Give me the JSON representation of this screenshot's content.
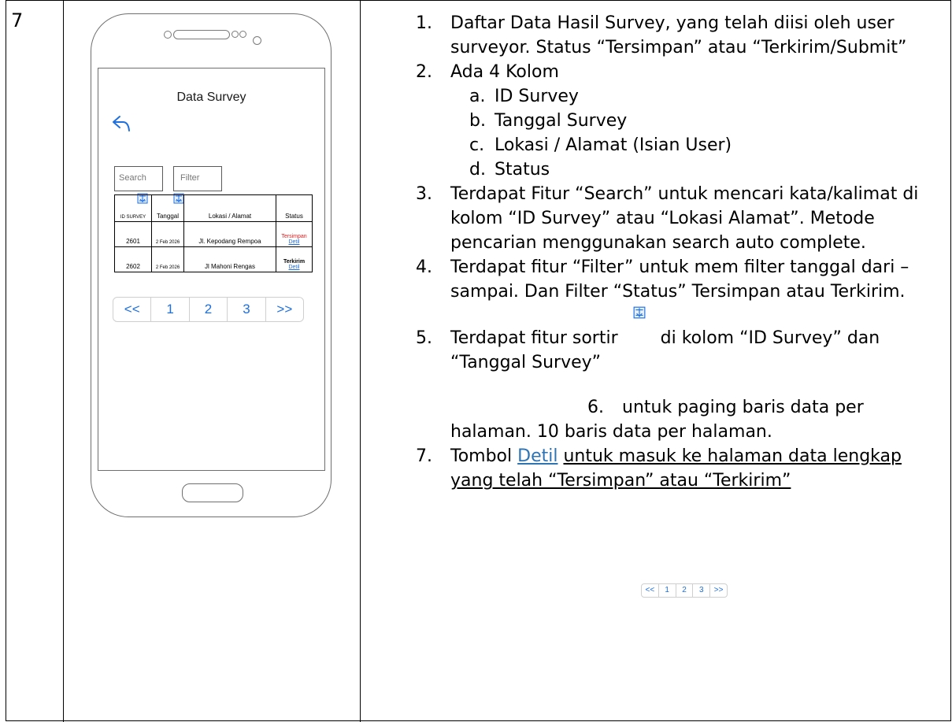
{
  "row_number": "7",
  "phone": {
    "screen_title": "Data Survey",
    "search_placeholder": "Search",
    "filter_placeholder": "Filter",
    "table": {
      "headers": [
        "ID SURVEY",
        "Tanggal",
        "Lokasi / Alamat",
        "Status"
      ],
      "rows": [
        {
          "id": "2601",
          "date": "2 Feb 2026",
          "location": "Jl. Kepodang Rempoa",
          "status": "Tersimpan",
          "status_color": "#e02020",
          "detail": "Detil"
        },
        {
          "id": "2602",
          "date": "2 Feb 2026",
          "location": "Jl Mahoni Rengas",
          "status": "Terkirim",
          "status_color": "#000000",
          "detail": "Detil"
        }
      ]
    },
    "pager": [
      "<<",
      "1",
      "2",
      "3",
      ">>"
    ]
  },
  "description": {
    "item1": {
      "num": "1.",
      "text": "Daftar Data Hasil Survey, yang telah diisi oleh user surveyor. Status “Tersimpan” atau “Terkirim/Submit”"
    },
    "item2": {
      "num": "2.",
      "text": "Ada 4 Kolom"
    },
    "columns": [
      {
        "letter": "a.",
        "text": "ID Survey"
      },
      {
        "letter": "b.",
        "text": "Tanggal Survey"
      },
      {
        "letter": "c.",
        "text": "Lokasi / Alamat (Isian User)"
      },
      {
        "letter": "d.",
        "text": "Status"
      }
    ],
    "item3": {
      "num": "3.",
      "text": "Terdapat Fitur “Search” untuk mencari kata/kalimat di kolom “ID Survey” atau “Lokasi Alamat”. Metode pencarian menggunakan search auto complete."
    },
    "item4": {
      "num": "4.",
      "text": "Terdapat fitur “Filter” untuk mem filter tanggal dari – sampai. Dan Filter “Status” Tersimpan atau Terkirim."
    },
    "item5": {
      "num": "5.",
      "text_before": "Terdapat fitur sortir",
      "text_after": "di kolom “ID Survey” dan “Tanggal Survey”"
    },
    "item6": {
      "num": "6.",
      "text": "untuk paging baris data per halaman. 10 baris data per halaman.",
      "pager": [
        "<<",
        "1",
        "2",
        "3",
        ">>"
      ]
    },
    "item7": {
      "num": "7.",
      "text_before": "Tombol",
      "link": "Detil",
      "text_after": "untuk masuk ke halaman data lengkap yang telah “Tersimpan” atau “Terkirim”"
    }
  },
  "colors": {
    "accent": "#1e6fe0",
    "link": "#2e74b5",
    "status_saved": "#e02020"
  }
}
